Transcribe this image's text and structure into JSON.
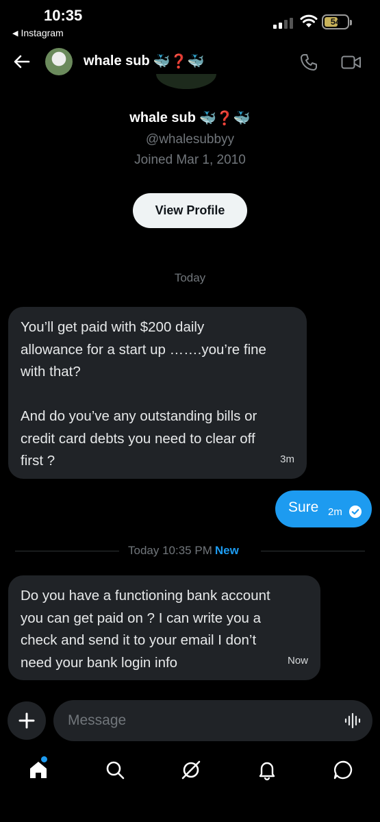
{
  "status_bar": {
    "time": "10:35",
    "back_app": "Instagram",
    "battery_level": "54"
  },
  "header": {
    "name": "whale sub",
    "name_emoji": "🐳❓🐳",
    "icons": [
      "back-arrow-icon",
      "phone-icon",
      "video-icon"
    ]
  },
  "profile": {
    "name": "whale sub",
    "handle": "@whalesubbyy",
    "joined": "Joined Mar 1, 2010",
    "view_profile_label": "View Profile"
  },
  "conversation": {
    "day_label": "Today",
    "messages": [
      {
        "direction": "incoming",
        "text": "You’ll get paid with $200 daily\nallowance for a start up …….you’re fine\nwith that?\n\nAnd do you’ve any outstanding bills or\ncredit card debts you need to clear off\nfirst ?",
        "time": "3m"
      },
      {
        "direction": "outgoing",
        "text": "Sure",
        "time": "2m"
      },
      {
        "direction": "incoming",
        "text": "Do you have a functioning bank account\nyou can get paid on ? I can write you a\ncheck and send it to your email  I don’t\nneed your bank login info",
        "time": "Now"
      }
    ],
    "new_separator": {
      "label": "Today 10:35 PM",
      "badge": "New"
    }
  },
  "composer": {
    "placeholder": "Message"
  },
  "tabbar": {
    "items": [
      "home-icon",
      "search-icon",
      "grok-icon",
      "notifications-icon",
      "messages-icon"
    ]
  },
  "colors": {
    "accent": "#1d9bf0",
    "bubble_incoming": "#202327",
    "background": "#000000"
  }
}
